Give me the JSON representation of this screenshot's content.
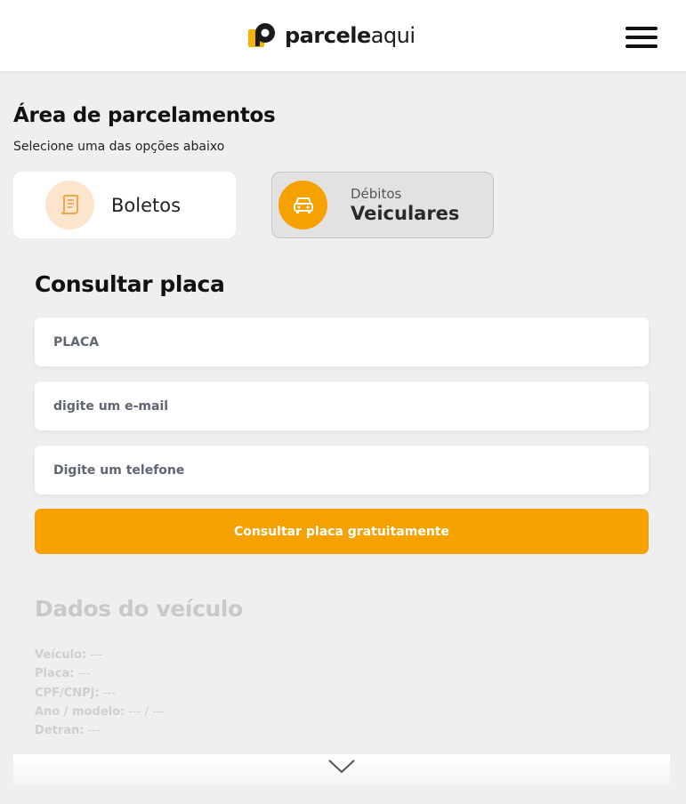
{
  "header": {
    "logo_bold": "parcele",
    "logo_light": "aqui",
    "menu_icon": "hamburger-menu-icon"
  },
  "area": {
    "title": "Área de parcelamentos",
    "subtitle": "Selecione uma das opções abaixo"
  },
  "options": {
    "boletos": {
      "label": "Boletos",
      "icon": "receipt-icon"
    },
    "veiculares": {
      "label_small": "Débitos",
      "label_big": "Veiculares",
      "icon": "car-icon"
    }
  },
  "consult": {
    "title": "Consultar placa",
    "placa_placeholder": "PLACA",
    "email_placeholder": "digite um e-mail",
    "phone_placeholder": "Digite um telefone",
    "submit_label": "Consultar placa gratuitamente"
  },
  "vehicle": {
    "title": "Dados do veículo",
    "rows": [
      {
        "key": "Veículo:",
        "value": " ---"
      },
      {
        "key": "Placa:",
        "value": " ---"
      },
      {
        "key": "CPF/CNPJ:",
        "value": " ---"
      },
      {
        "key": "Ano / modelo:",
        "value": " --- / ---"
      },
      {
        "key": "Detran:",
        "value": " ---"
      }
    ]
  },
  "colors": {
    "accent": "#f5a100",
    "accent_light": "#fde4cd",
    "background": "#efefef"
  },
  "scroll_icon": "chevron-down-icon"
}
